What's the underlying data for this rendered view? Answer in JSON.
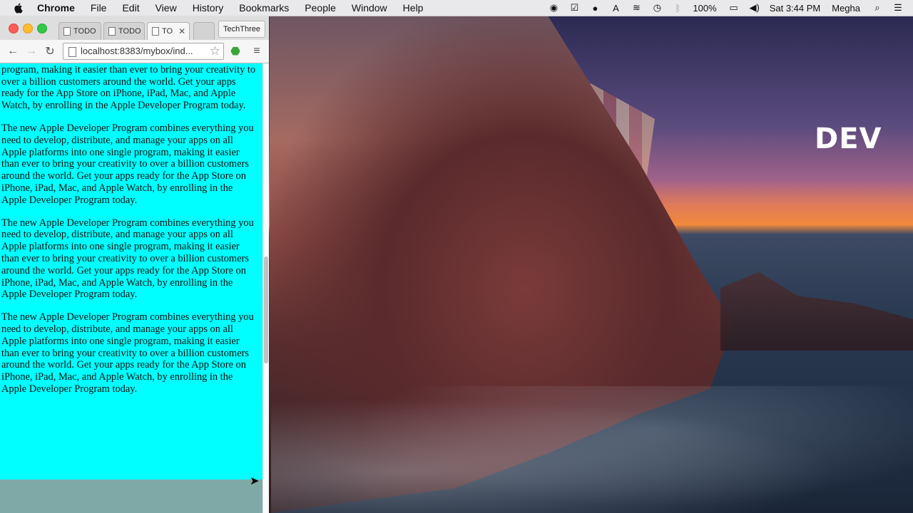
{
  "menubar": {
    "app_name": "Chrome",
    "items": [
      "File",
      "Edit",
      "View",
      "History",
      "Bookmarks",
      "People",
      "Window",
      "Help"
    ],
    "battery": "100%",
    "clock": "Sat 3:44 PM",
    "user": "Megha"
  },
  "browser": {
    "tabs": [
      {
        "title": "TODO"
      },
      {
        "title": "TODO"
      },
      {
        "title": "TO"
      }
    ],
    "profile_button": "TechThree",
    "url": "localhost:8383/mybox/ind..."
  },
  "page": {
    "partial_paragraph": "manage your apps on all Apple platforms into one single program, making it easier than ever to bring your creativity to over a billion customers around the world. Get your apps ready for the App Store on iPhone, iPad, Mac, and Apple Watch, by enrolling in the Apple Developer Program today.",
    "paragraphs": [
      "The new Apple Developer Program combines everything you need to develop, distribute, and manage your apps on all Apple platforms into one single program, making it easier than ever to bring your creativity to over a billion customers around the world. Get your apps ready for the App Store on iPhone, iPad, Mac, and Apple Watch, by enrolling in the Apple Developer Program today.",
      "The new Apple Developer Program combines everything you need to develop, distribute, and manage your apps on all Apple platforms into one single program, making it easier than ever to bring your creativity to over a billion customers around the world. Get your apps ready for the App Store on iPhone, iPad, Mac, and Apple Watch, by enrolling in the Apple Developer Program today.",
      "The new Apple Developer Program combines everything you need to develop, distribute, and manage your apps on all Apple platforms into one single program, making it easier than ever to bring your creativity to over a billion customers around the world. Get your apps ready for the App Store on iPhone, iPad, Mac, and Apple Watch, by enrolling in the Apple Developer Program today."
    ],
    "background_color": "#00ffff",
    "footer_color": "#7fa9a6"
  },
  "desktop": {
    "logo_text": "DEV"
  }
}
